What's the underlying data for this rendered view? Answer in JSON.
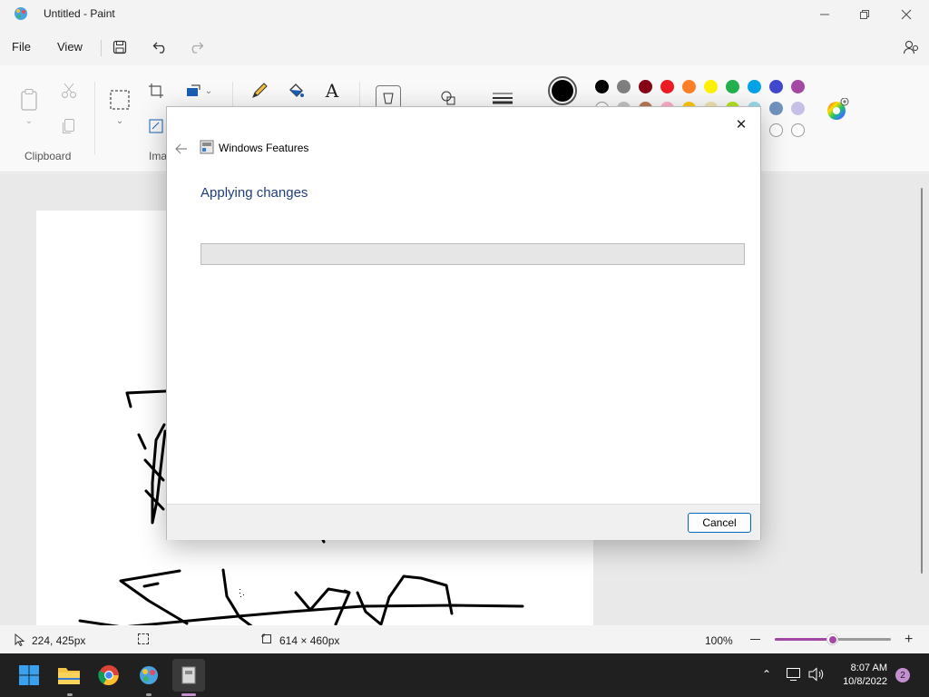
{
  "window": {
    "title": "Untitled - Paint"
  },
  "menu": {
    "file": "File",
    "view": "View"
  },
  "ribbon": {
    "clipboard_label": "Clipboard",
    "image_label": "Ima"
  },
  "colors": {
    "row1": [
      "#000000",
      "#7f7f7f",
      "#880015",
      "#ed1c24",
      "#ff7f27",
      "#fff200",
      "#22b14c",
      "#00a2e8",
      "#3f48cc",
      "#a349a4"
    ],
    "row2": [
      "#ffffff",
      "#c3c3c3",
      "#b97a57",
      "#ffaec9",
      "#ffc90e",
      "#efe4b0",
      "#b5e61d",
      "#99d9ea",
      "#7092be",
      "#c8bfe7"
    ],
    "current": "#000000"
  },
  "status": {
    "cursor": "224, 425px",
    "canvas_size": "614 × 460px",
    "zoom": "100%",
    "zoom_level": 0.5
  },
  "dialog": {
    "title": "Windows Features",
    "heading": "Applying changes",
    "progress": 0,
    "cancel": "Cancel"
  },
  "taskbar": {
    "time": "8:07 AM",
    "date": "10/8/2022",
    "notifications": "2"
  }
}
